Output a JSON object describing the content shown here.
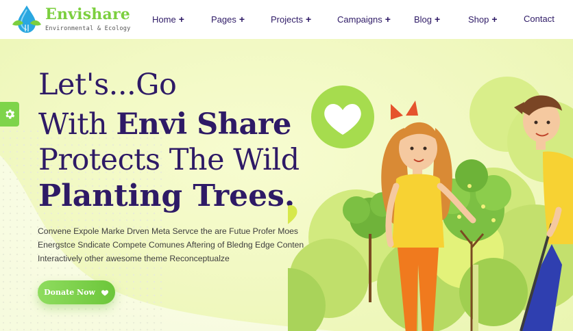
{
  "brand": {
    "name": "Envishare",
    "tagline": "Environmental & Ecology",
    "logo_icon": "water-drop-leaf-icon"
  },
  "nav": {
    "items": [
      {
        "label": "Home",
        "has_submenu": true,
        "indicator": "+"
      },
      {
        "label": "Pages",
        "has_submenu": true,
        "indicator": "+"
      },
      {
        "label": "Projects",
        "has_submenu": true,
        "indicator": "+"
      },
      {
        "label": "Campaigns",
        "has_submenu": true,
        "indicator": "+"
      },
      {
        "label": "Blog",
        "has_submenu": true,
        "indicator": "+"
      },
      {
        "label": "Shop",
        "has_submenu": true,
        "indicator": "+"
      },
      {
        "label": "Contact",
        "has_submenu": false,
        "indicator": ""
      }
    ]
  },
  "hero": {
    "line1": "Let's...Go",
    "line2_prefix": "With ",
    "line2_bold": "Envi Share",
    "line3": "Protects The Wild",
    "line4": "Planting Trees.",
    "description": "Convene Expole Marke Drven Meta Servce the are Futue Profer Moes Energstce Sndicate Compete Comunes Aftering of Bledng Edge Conten Interactively other awesome theme Reconceptualze",
    "cta_label": "Donate Now",
    "cta_icon": "heart-icon"
  },
  "settings": {
    "icon": "gear-icon"
  },
  "colors": {
    "primary_dark": "#2e1a66",
    "accent_green": "#7ed44a",
    "hero_bg": "#f2f9c4",
    "heart_badge": "#a6dc4e"
  }
}
